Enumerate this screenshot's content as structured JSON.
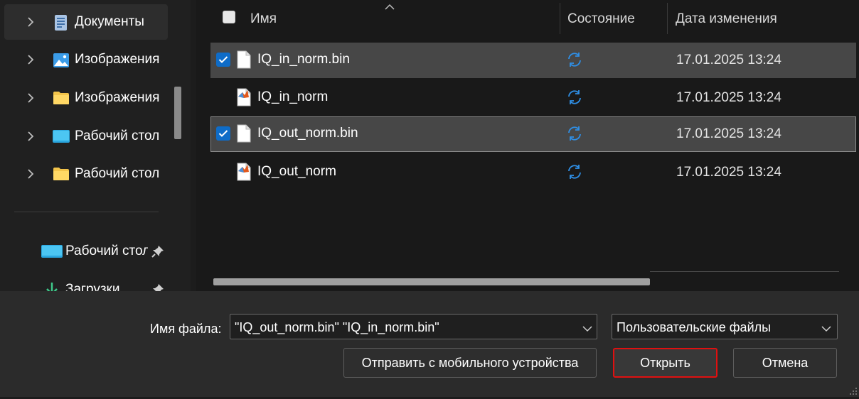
{
  "sidebar": {
    "items": [
      {
        "label": "Документы",
        "icon": "documents-icon",
        "active": true
      },
      {
        "label": "Изображения",
        "icon": "pictures-icon",
        "active": false
      },
      {
        "label": "Изображения",
        "icon": "folder-icon",
        "active": false
      },
      {
        "label": "Рабочий стол",
        "icon": "desktop-icon",
        "active": false
      },
      {
        "label": "Рабочий стол",
        "icon": "folder-icon",
        "active": false
      }
    ],
    "pinned": [
      {
        "label": "Рабочий стол",
        "icon": "desktop-icon"
      },
      {
        "label": "Загрузки",
        "icon": "downloads-icon"
      }
    ]
  },
  "file_list": {
    "columns": {
      "name": "Имя",
      "status": "Состояние",
      "date": "Дата изменения"
    },
    "rows": [
      {
        "name": "IQ_in_norm.bin",
        "type": "file",
        "status_icon": "sync-icon",
        "date": "17.01.2025 13:24",
        "selected": true
      },
      {
        "name": "IQ_in_norm",
        "type": "matlab-file",
        "status_icon": "sync-icon",
        "date": "17.01.2025 13:24",
        "selected": false
      },
      {
        "name": "IQ_out_norm.bin",
        "type": "file",
        "status_icon": "sync-icon",
        "date": "17.01.2025 13:24",
        "selected": true
      },
      {
        "name": "IQ_out_norm",
        "type": "matlab-file",
        "status_icon": "sync-icon",
        "date": "17.01.2025 13:24",
        "selected": false
      }
    ]
  },
  "footer": {
    "filename_label": "Имя файла:",
    "filename_value": "\"IQ_out_norm.bin\" \"IQ_in_norm.bin\"",
    "filetype_value": "Пользовательские файлы",
    "mobile_button": "Отправить с мобильного устройства",
    "open_button": "Открыть",
    "cancel_button": "Отмена"
  },
  "colors": {
    "accent": "#0e6cc8",
    "sync": "#2f8fe6",
    "focus_border": "#e01010"
  }
}
